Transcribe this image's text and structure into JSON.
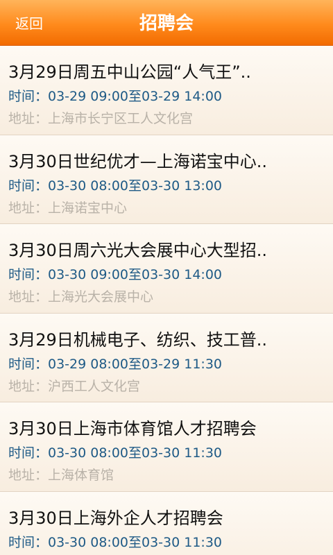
{
  "header": {
    "back_label": "返回",
    "title": "招聘会"
  },
  "items": [
    {
      "title": "3月29日周五中山公园“人气王”..",
      "time": "时间：03-29 09:00至03-29 14:00",
      "address": "地址：上海市长宁区工人文化宫"
    },
    {
      "title": "3月30日世纪优才—上海诺宝中心..",
      "time": "时间：03-30 08:00至03-30 13:00",
      "address": "地址：上海诺宝中心"
    },
    {
      "title": "3月30日周六光大会展中心大型招..",
      "time": "时间：03-30 09:00至03-30 14:00",
      "address": "地址：上海光大会展中心"
    },
    {
      "title": "3月29日机械电子、纺织、技工普..",
      "time": "时间：03-29 08:00至03-29 11:30",
      "address": "地址：沪西工人文化宫"
    },
    {
      "title": "3月30日上海市体育馆人才招聘会",
      "time": "时间：03-30 08:00至03-30 11:30",
      "address": "地址：上海体育馆"
    },
    {
      "title": "3月30日上海外企人才招聘会",
      "time": "时间：03-30 08:00至03-30 11:30",
      "address": ""
    }
  ]
}
